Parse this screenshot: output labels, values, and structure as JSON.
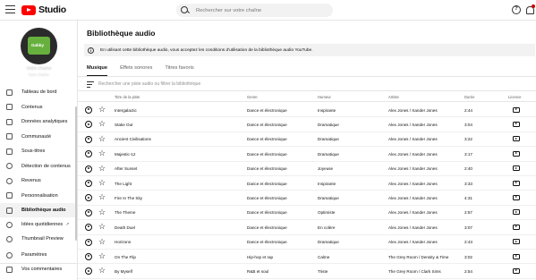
{
  "header": {
    "app_name": "Studio",
    "search_placeholder": "Rechercher sur votre chaîne",
    "help_icon": "help-icon",
    "notifications_icon": "bell-icon"
  },
  "sidebar": {
    "channel_name": "Votre chaîne",
    "channel_sub": "Nom chaîne",
    "avatar_text": "Gabby",
    "items": [
      {
        "label": "Tableau de bord",
        "icon": "dashboard-icon"
      },
      {
        "label": "Contenus",
        "icon": "content-icon"
      },
      {
        "label": "Données analytiques",
        "icon": "analytics-icon"
      },
      {
        "label": "Communauté",
        "icon": "community-icon"
      },
      {
        "label": "Sous-titres",
        "icon": "subtitles-icon"
      },
      {
        "label": "Détection de contenus",
        "icon": "copyright-icon"
      },
      {
        "label": "Revenus",
        "icon": "dollar-icon"
      },
      {
        "label": "Personnalisation",
        "icon": "customization-icon"
      },
      {
        "label": "Bibliothèque audio",
        "icon": "audio-library-icon"
      },
      {
        "label": "Idées quotidiennes",
        "icon": "ideas-icon"
      },
      {
        "label": "Thumbnail Preview",
        "icon": "thumbnail-icon"
      },
      {
        "label": "Paramètres",
        "icon": "settings-icon"
      },
      {
        "label": "Vos commentaires",
        "icon": "feedback-icon"
      }
    ]
  },
  "main": {
    "title": "Bibliothèque audio",
    "notice": "En utilisant cette bibliothèque audio, vous acceptez les conditions d'utilisation de la bibliothèque audio YouTube.",
    "tabs": [
      {
        "label": "Musique"
      },
      {
        "label": "Effets sonores"
      },
      {
        "label": "Titres favoris"
      }
    ],
    "filter_placeholder": "Rechercher une piste audio ou filtrer la bibliothèque",
    "columns": {
      "title": "Titre de la piste",
      "genre": "Genre",
      "mood": "Humeur",
      "artist": "Artiste",
      "duration": "Durée",
      "license": "Licence"
    },
    "rows": [
      {
        "title": "Intergalactic",
        "genre": "Dance et électronique",
        "mood": "Inspirante",
        "artist": "Alex Jones / Xander Jones",
        "duration": "2:44"
      },
      {
        "title": "Stake Out",
        "genre": "Dance et électronique",
        "mood": "Dramatique",
        "artist": "Alex Jones / Xander Jones",
        "duration": "3:04"
      },
      {
        "title": "Ancient Civilisations",
        "genre": "Dance et électronique",
        "mood": "Dramatique",
        "artist": "Alex Jones / Xander Jones",
        "duration": "3:22"
      },
      {
        "title": "Majestic-12",
        "genre": "Dance et électronique",
        "mood": "Dramatique",
        "artist": "Alex Jones / Xander Jones",
        "duration": "3:17"
      },
      {
        "title": "After Sunset",
        "genre": "Dance et électronique",
        "mood": "Joyeuse",
        "artist": "Alex Jones / Xander Jones",
        "duration": "2:40"
      },
      {
        "title": "The Light",
        "genre": "Dance et électronique",
        "mood": "Inspirante",
        "artist": "Alex Jones / Xander Jones",
        "duration": "3:33"
      },
      {
        "title": "Fire In The Sky",
        "genre": "Dance et électronique",
        "mood": "Dramatique",
        "artist": "Alex Jones / Xander Jones",
        "duration": "4:31"
      },
      {
        "title": "The Theme",
        "genre": "Dance et électronique",
        "mood": "Optimiste",
        "artist": "Alex Jones / Xander Jones",
        "duration": "2:57"
      },
      {
        "title": "Death Duel",
        "genre": "Dance et électronique",
        "mood": "En colère",
        "artist": "Alex Jones / Xander Jones",
        "duration": "3:07"
      },
      {
        "title": "Horizons",
        "genre": "Dance et électronique",
        "mood": "Dramatique",
        "artist": "Alex Jones / Xander Jones",
        "duration": "2:43"
      },
      {
        "title": "On The Flip",
        "genre": "Hip-hop et rap",
        "mood": "Calme",
        "artist": "The Grey Room / Density & Time",
        "duration": "3:02"
      },
      {
        "title": "By Myself",
        "genre": "R&B et soul",
        "mood": "Triste",
        "artist": "The Grey Room / Clark Sims",
        "duration": "2:54"
      }
    ]
  },
  "colors": {
    "brand_red": "#ff0000",
    "active_bg": "#f2f2f2"
  }
}
